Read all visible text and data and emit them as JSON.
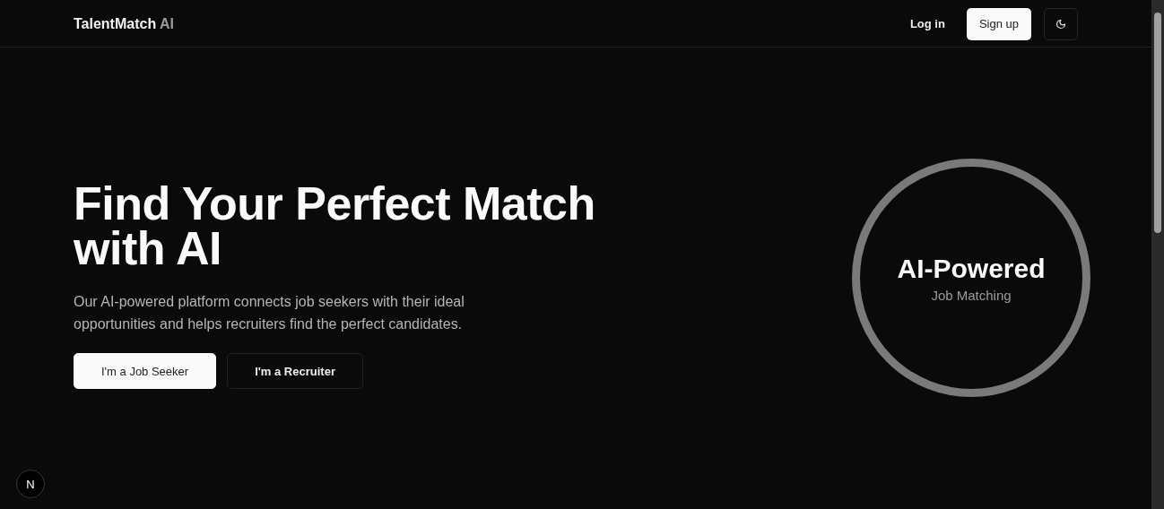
{
  "header": {
    "brand": "TalentMatch",
    "brand_suffix": "AI",
    "login": "Log in",
    "signup": "Sign up"
  },
  "hero": {
    "title": "Find Your Perfect Match with AI",
    "description": "Our AI-powered platform connects job seekers with their ideal opportunities and helps recruiters find the perfect candidates.",
    "buttons": [
      {
        "label": "I'm a Job Seeker",
        "kind": "primary"
      },
      {
        "label": "I'm a Recruiter",
        "kind": "outline"
      }
    ]
  },
  "badge": {
    "title": "AI-Powered",
    "subtitle": "Job Matching"
  },
  "dev_indicator": "N"
}
